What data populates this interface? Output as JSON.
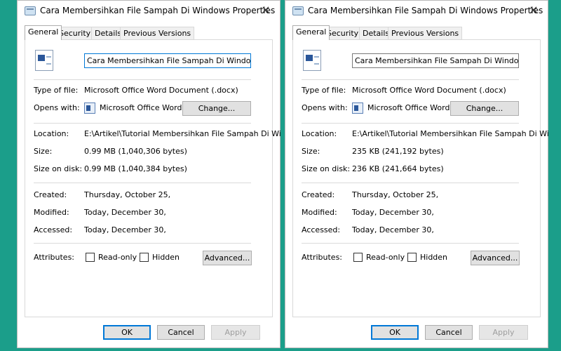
{
  "windows": [
    {
      "title": "Cara Membersihkan File Sampah Di Windows Properties",
      "tabs": [
        "General",
        "Security",
        "Details",
        "Previous Versions"
      ],
      "file_name": "Cara Membersihkan File Sampah Di Windows",
      "type_of_file_label": "Type of file:",
      "type_of_file": "Microsoft Office Word Document (.docx)",
      "opens_with_label": "Opens with:",
      "opens_with": "Microsoft Office Word",
      "change_button": "Change...",
      "location_label": "Location:",
      "location": "E:\\Artikel\\Tutorial Membersihkan File Sampah Di Wi",
      "size_label": "Size:",
      "size": "0.99 MB (1,040,306 bytes)",
      "size_on_disk_label": "Size on disk:",
      "size_on_disk": "0.99 MB (1,040,384 bytes)",
      "created_label": "Created:",
      "created": "Thursday, October 25,",
      "modified_label": "Modified:",
      "modified": "Today, December 30,",
      "accessed_label": "Accessed:",
      "accessed": "Today, December 30,",
      "attributes_label": "Attributes:",
      "read_only_label": "Read-only",
      "hidden_label": "Hidden",
      "read_only_checked": false,
      "hidden_checked": false,
      "advanced_button": "Advanced...",
      "ok_button": "OK",
      "cancel_button": "Cancel",
      "apply_button": "Apply"
    },
    {
      "title": "Cara Membersihkan File Sampah Di Windows Properties",
      "tabs": [
        "General",
        "Security",
        "Details",
        "Previous Versions"
      ],
      "file_name": "Cara Membersihkan File Sampah Di Windows",
      "type_of_file_label": "Type of file:",
      "type_of_file": "Microsoft Office Word Document (.docx)",
      "opens_with_label": "Opens with:",
      "opens_with": "Microsoft Office Word",
      "change_button": "Change...",
      "location_label": "Location:",
      "location": "E:\\Artikel\\Tutorial Membersihkan File Sampah Di Wi",
      "size_label": "Size:",
      "size": "235 KB (241,192 bytes)",
      "size_on_disk_label": "Size on disk:",
      "size_on_disk": "236 KB (241,664 bytes)",
      "created_label": "Created:",
      "created": "Thursday, October 25,",
      "modified_label": "Modified:",
      "modified": "Today, December 30,",
      "accessed_label": "Accessed:",
      "accessed": "Today, December 30,",
      "attributes_label": "Attributes:",
      "read_only_label": "Read-only",
      "hidden_label": "Hidden",
      "read_only_checked": false,
      "hidden_checked": false,
      "advanced_button": "Advanced...",
      "ok_button": "OK",
      "cancel_button": "Cancel",
      "apply_button": "Apply"
    }
  ],
  "colors": {
    "background": "#1b9e8a",
    "accent": "#0078d7",
    "word_blue": "#2b579a"
  }
}
